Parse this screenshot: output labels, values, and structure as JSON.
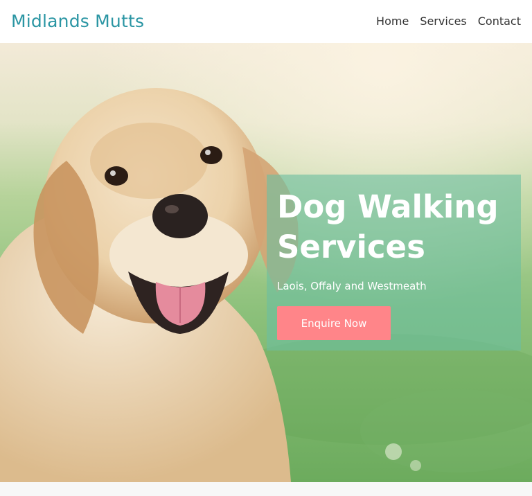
{
  "header": {
    "brand": "Midlands Mutts",
    "nav": [
      {
        "label": "Home"
      },
      {
        "label": "Services"
      },
      {
        "label": "Contact"
      }
    ]
  },
  "hero": {
    "image": "golden-retriever-photo",
    "title_line1": "Dog Walking",
    "title_line2": "Services",
    "subtitle": "Laois, Offaly and Westmeath",
    "cta_label": "Enquire Now"
  },
  "colors": {
    "brand": "#2a95a3",
    "cta": "#ff8589",
    "card": "#6cbea0"
  }
}
